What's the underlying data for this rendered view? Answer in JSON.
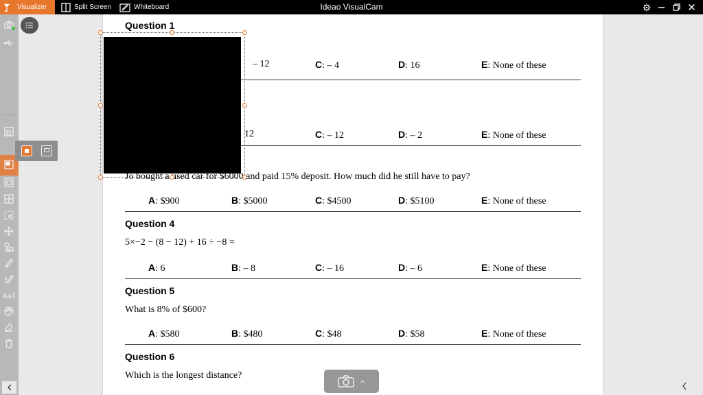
{
  "titlebar": {
    "tabs": [
      {
        "label": "Visualizer"
      },
      {
        "label": "Split Screen"
      },
      {
        "label": "Whiteboard"
      }
    ],
    "app_title": "Ideao VisualCam",
    "controls": [
      "gear-icon",
      "minimize-icon",
      "restore-icon",
      "close-icon"
    ]
  },
  "accent": "#e8772e",
  "document": {
    "q1": {
      "heading": "Question 1",
      "answers_row1": [
        {
          "text": "– 12"
        },
        {
          "key": "C",
          "text": ": – 4"
        },
        {
          "key": "D",
          "text": ": 16"
        },
        {
          "key": "E",
          "text": ": None of these"
        }
      ],
      "answers_row2": [
        {
          "text": "12"
        },
        {
          "key": "C",
          "text": ": – 12"
        },
        {
          "key": "D",
          "text": ": – 2"
        },
        {
          "key": "E",
          "text": ": None of these"
        }
      ]
    },
    "q3": {
      "text": "Jo bought a used car for $6000 and paid 15% deposit. How much did he still have to pay?",
      "answers": [
        {
          "key": "A",
          "text": ": $900"
        },
        {
          "key": "B",
          "text": ": $5000"
        },
        {
          "key": "C",
          "text": ": $4500"
        },
        {
          "key": "D",
          "text": ": $5100"
        },
        {
          "key": "E",
          "text": ": None of these"
        }
      ]
    },
    "q4": {
      "heading": "Question 4",
      "text": "5×−2 − (8 − 12) + 16 ÷ −8 =",
      "answers": [
        {
          "key": "A",
          "text": ": 6"
        },
        {
          "key": "B",
          "text": ": – 8"
        },
        {
          "key": "C",
          "text": ": – 16"
        },
        {
          "key": "D",
          "text": ": – 6"
        },
        {
          "key": "E",
          "text": ": None of these"
        }
      ]
    },
    "q5": {
      "heading": "Question 5",
      "text": "What is 8% of $600?",
      "answers": [
        {
          "key": "A",
          "text": ": $580"
        },
        {
          "key": "B",
          "text": ": $480"
        },
        {
          "key": "C",
          "text": ": $48"
        },
        {
          "key": "D",
          "text": ": $58"
        },
        {
          "key": "E",
          "text": ": None of these"
        }
      ]
    },
    "q6": {
      "heading": "Question 6",
      "text": "Which is the longest distance?"
    }
  }
}
